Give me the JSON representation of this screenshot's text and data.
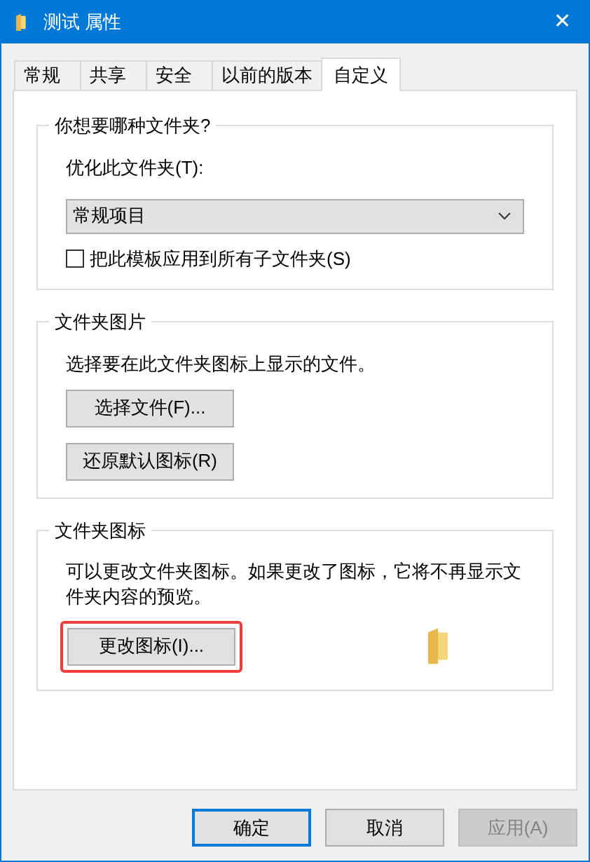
{
  "window": {
    "title": "测试 属性",
    "close": "✕"
  },
  "tabs": [
    {
      "label": "常规",
      "selected": false
    },
    {
      "label": "共享",
      "selected": false
    },
    {
      "label": "安全",
      "selected": false
    },
    {
      "label": "以前的版本",
      "selected": false
    },
    {
      "label": "自定义",
      "selected": true
    }
  ],
  "folder_type": {
    "title": "你想要哪种文件夹?",
    "label": "优化此文件夹(T):",
    "dropdown": {
      "value": "常规项目"
    },
    "checkbox": {
      "label": "把此模板应用到所有子文件夹(S)",
      "checked": false
    }
  },
  "folder_pictures": {
    "title": "文件夹图片",
    "description": "选择要在此文件夹图标上显示的文件。",
    "buttons": [
      {
        "label": "选择文件(F)..."
      },
      {
        "label": "还原默认图标(R)"
      }
    ]
  },
  "folder_icons": {
    "title": "文件夹图标",
    "description": "可以更改文件夹图标。如果更改了图标，它将不再显示文件夹内容的预览。",
    "button": {
      "label": "更改图标(I)...",
      "highlighted": true
    }
  },
  "buttons": [
    {
      "label": "确定",
      "default": true,
      "disabled": false
    },
    {
      "label": "取消",
      "default": false,
      "disabled": false
    },
    {
      "label": "应用(A)",
      "default": false,
      "disabled": true
    }
  ]
}
